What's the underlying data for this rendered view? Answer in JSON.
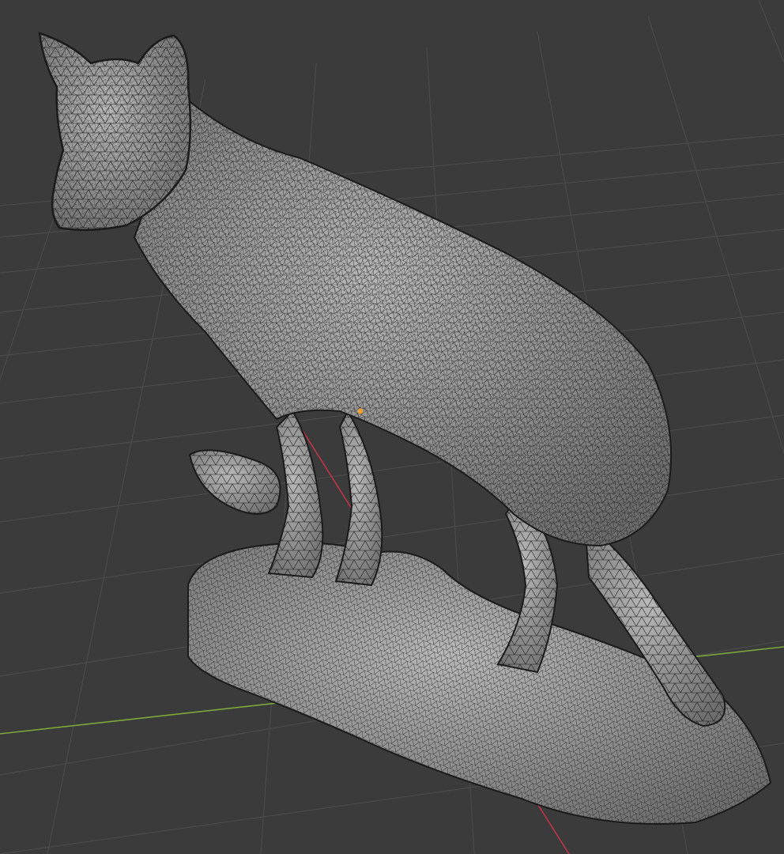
{
  "viewport": {
    "background": "#3b3b3b",
    "grid_color": "#4a4a4a",
    "x_axis_color": "#c0344a",
    "y_axis_color": "#7fa83a",
    "origin_color": "#f0a030",
    "mesh_fill": "#a8a8a8",
    "mesh_line": "#1e1e1e",
    "overlay": "wireframe",
    "object": "fox-statue-mesh"
  }
}
